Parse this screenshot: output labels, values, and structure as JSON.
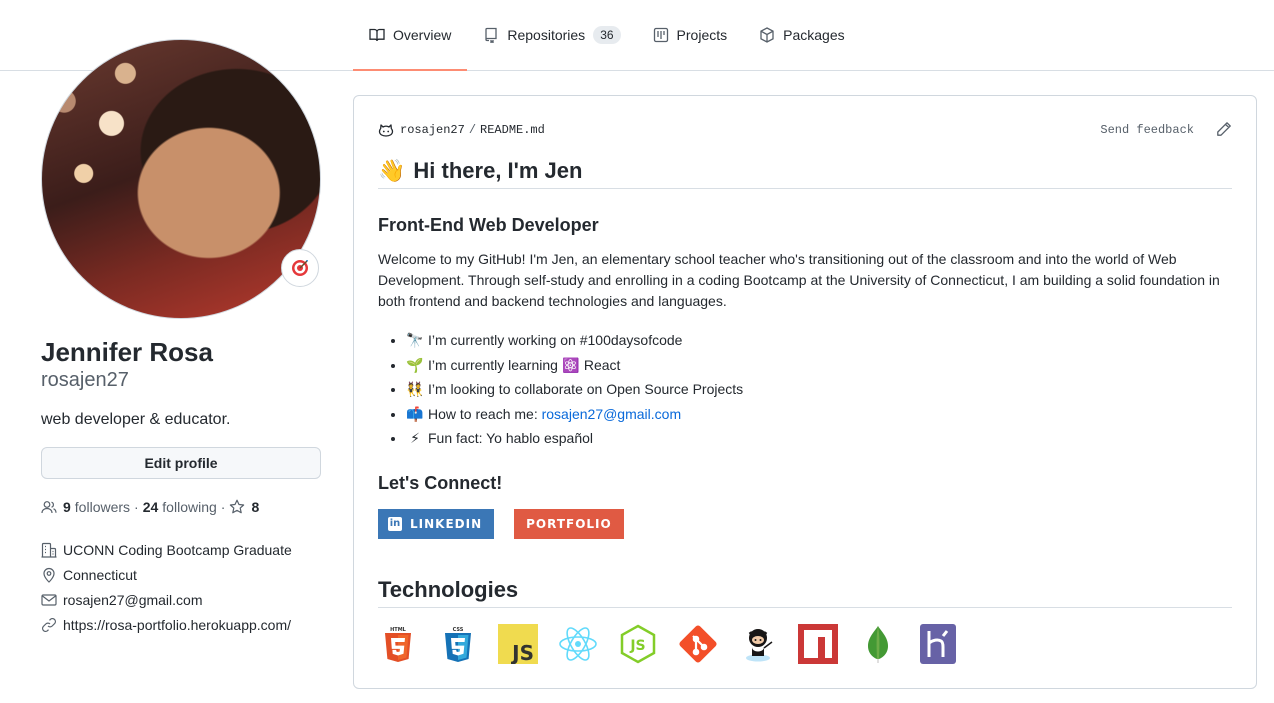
{
  "tabs": [
    {
      "label": "Overview",
      "icon": "book-icon",
      "active": true
    },
    {
      "label": "Repositories",
      "icon": "repo-icon",
      "count": "36"
    },
    {
      "label": "Projects",
      "icon": "project-icon"
    },
    {
      "label": "Packages",
      "icon": "package-icon"
    }
  ],
  "profile": {
    "fullname": "Jennifer Rosa",
    "username": "rosajen27",
    "bio": "web developer & educator.",
    "edit_label": "Edit profile",
    "followers_count": "9",
    "followers_label": "followers",
    "following_count": "24",
    "following_label": "following",
    "stars_count": "8",
    "details": {
      "organization": "UCONN Coding Bootcamp Graduate",
      "location": "Connecticut",
      "email": "rosajen27@gmail.com",
      "website": "https://rosa-portfolio.herokuapp.com/"
    }
  },
  "readme": {
    "owner": "rosajen27",
    "file": "README.md",
    "feedback": "Send feedback",
    "greeting": "Hi there, I'm Jen",
    "role": "Front-End Web Developer",
    "intro": "Welcome to my GitHub! I'm Jen, an elementary school teacher who's transitioning out of the classroom and into the world of Web Development. Through self-study and enrolling in a coding Bootcamp at the University of Connecticut, I am building a solid foundation in both frontend and backend technologies and languages.",
    "bullets": {
      "working": "I’m currently working on #100daysofcode",
      "learning_prefix": "I’m currently learning",
      "learning_item": "React",
      "collab": "I’m looking to collaborate on Open Source Projects",
      "reach_prefix": "How to reach me:",
      "reach_email": "rosajen27@gmail.com",
      "fun": "Fun fact: Yo hablo español"
    },
    "connect_heading": "Let's Connect!",
    "linkedin_label": "LINKEDIN",
    "portfolio_label": "PORTFOLIO",
    "tech_heading": "Technologies",
    "technologies": [
      "html5-icon",
      "css3-icon",
      "javascript-icon",
      "react-icon",
      "nodejs-icon",
      "git-icon",
      "github-icon",
      "npm-icon",
      "mongodb-icon",
      "heroku-icon"
    ]
  },
  "colors": {
    "accent_underline": "#fd8c73",
    "link": "#0969da",
    "linkedin": "#3b77b6",
    "portfolio": "#e05a43"
  }
}
